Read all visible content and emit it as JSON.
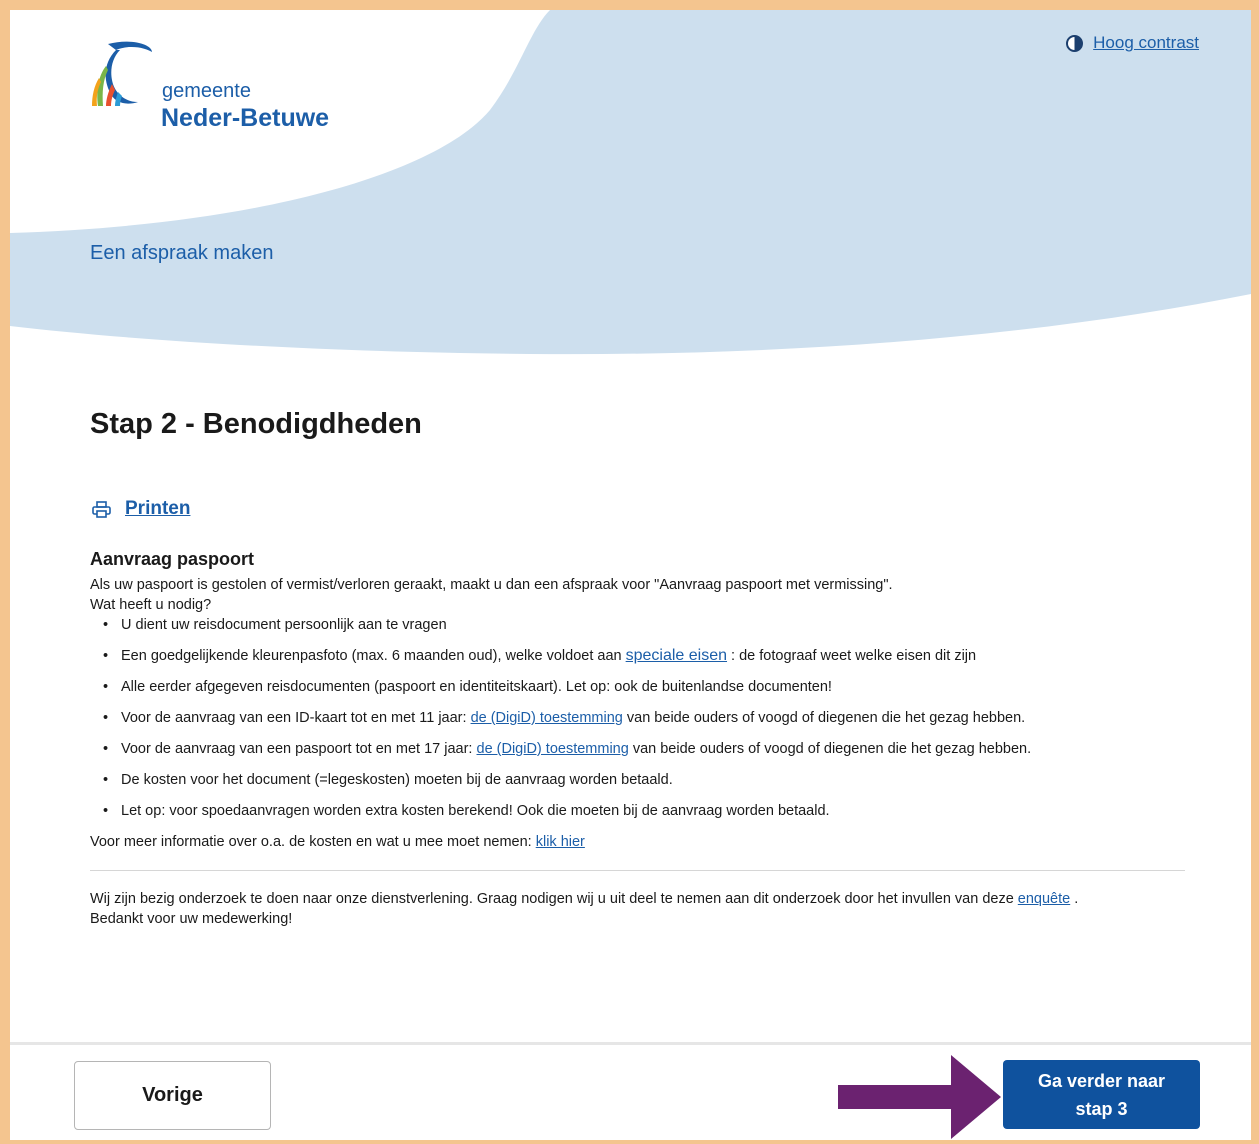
{
  "header": {
    "logo_small": "gemeente",
    "logo_big": "Neder-Betuwe",
    "contrast_link": "Hoog contrast",
    "title": "Een afspraak maken"
  },
  "step_title": "Stap 2 - Benodigdheden",
  "print_label": "Printen",
  "section": {
    "heading": "Aanvraag paspoort",
    "intro": "Als uw paspoort is gestolen of vermist/verloren geraakt, maakt u dan een afspraak voor \"Aanvraag paspoort met vermissing\".",
    "question": "Wat heeft u nodig?",
    "items": {
      "i0": {
        "text": "U dient uw reisdocument persoonlijk aan te vragen"
      },
      "i1": {
        "before": "Een goedgelijkende kleurenpasfoto (max. 6 maanden oud), welke voldoet aan ",
        "link": "speciale eisen",
        "after": " : de fotograaf weet welke eisen dit zijn"
      },
      "i2": {
        "text": "Alle eerder afgegeven reisdocumenten (paspoort en identiteitskaart). Let op: ook de buitenlandse documenten!"
      },
      "i3": {
        "before": "Voor de aanvraag van een ID-kaart tot en met 11 jaar: ",
        "link": "de (DigiD) toestemming",
        "after": " van beide ouders of voogd of diegenen die het gezag hebben."
      },
      "i4": {
        "before": "Voor de aanvraag van een paspoort tot en met 17 jaar: ",
        "link": "de (DigiD) toestemming",
        "after": "  van beide ouders of voogd of diegenen die het gezag hebben."
      },
      "i5": {
        "text": "De kosten voor het document (=legeskosten) moeten bij de aanvraag worden betaald."
      },
      "i6": {
        "text": "Let op: voor spoedaanvragen worden extra kosten berekend! Ook die moeten bij de aanvraag worden betaald."
      }
    },
    "more_text": "Voor meer informatie over o.a. de kosten en wat u mee moet nemen: ",
    "more_link": "klik hier"
  },
  "survey": {
    "text": "Wij zijn bezig onderzoek te doen naar onze dienstverlening. Graag nodigen wij u uit deel te nemen aan dit onderzoek door het invullen van deze ",
    "link": "enquête",
    "after": " .",
    "thanks": "Bedankt voor uw medewerking!"
  },
  "footer": {
    "prev_label": "Vorige",
    "next_label": "Ga verder naar stap 3"
  },
  "colors": {
    "frame": "#f4c58f",
    "hero_wave": "#cddfee",
    "link": "#1c5ea8",
    "primary_button": "#0f529e",
    "annotation_arrow": "#6b2270"
  },
  "icons": [
    "contrast-icon",
    "printer-icon",
    "logo-mark-icon",
    "annotation-arrow-icon"
  ]
}
